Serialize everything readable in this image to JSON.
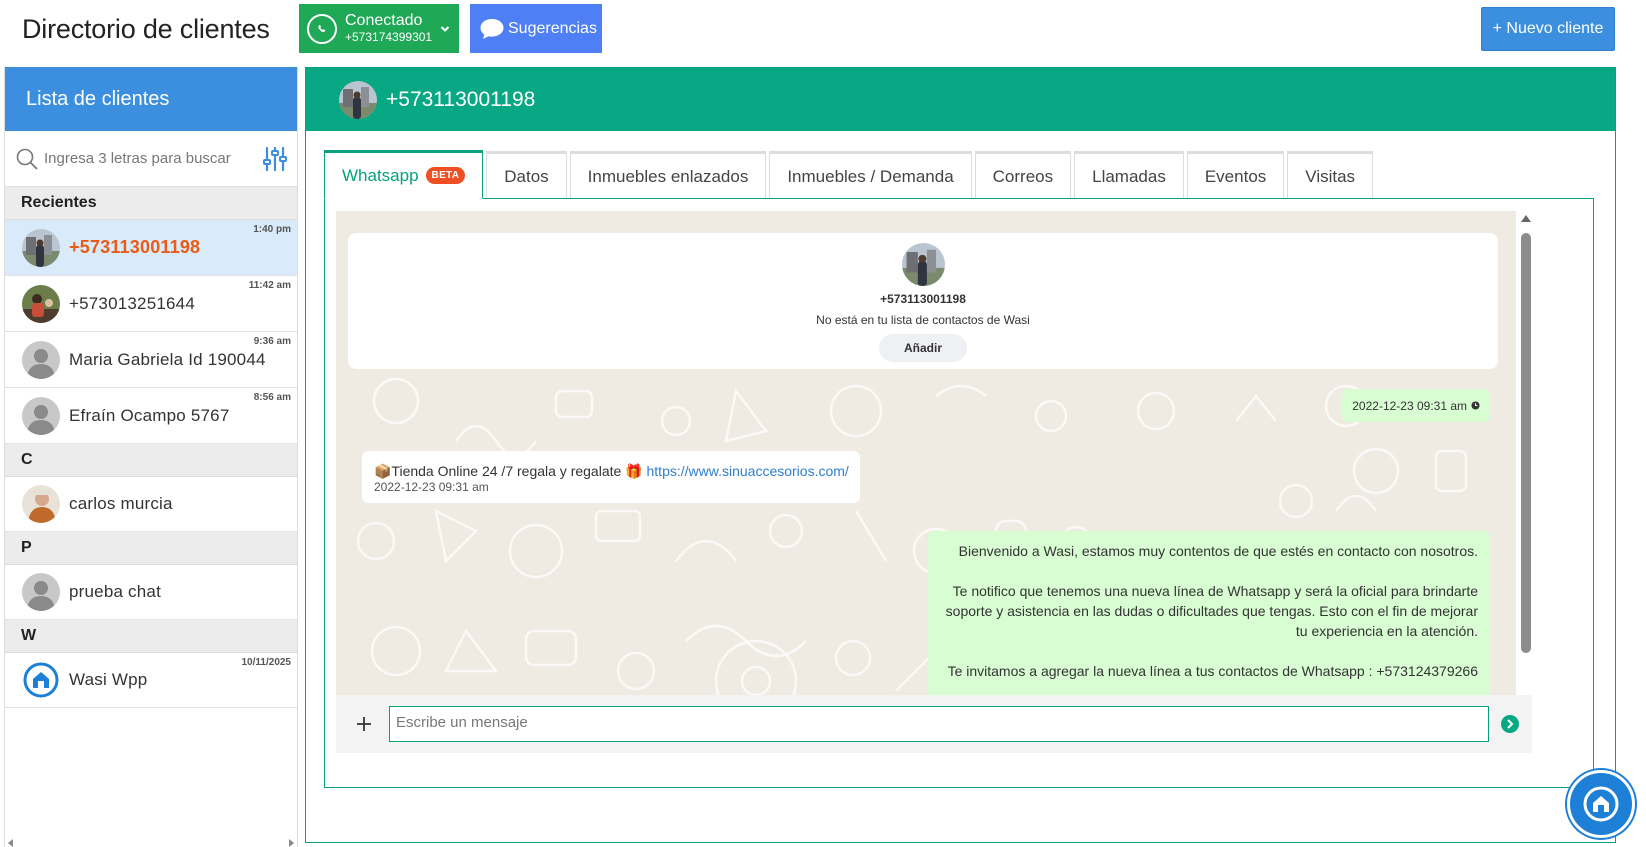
{
  "header": {
    "title": "Directorio de clientes",
    "whatsapp_state": "Conectado",
    "whatsapp_phone": "+573174399301",
    "suggestions_label": "Sugerencias",
    "new_client_label": "+ Nuevo cliente"
  },
  "sidebar": {
    "title": "Lista de clientes",
    "search_placeholder": "Ingresa 3 letras para buscar",
    "sections": [
      {
        "label": "Recientes",
        "contacts": [
          {
            "name": "+573113001198",
            "time": "1:40 pm",
            "active": true
          },
          {
            "name": "+573013251644",
            "time": "11:42 am"
          },
          {
            "name": "Maria Gabriela Id 190044",
            "time": "9:36 am"
          },
          {
            "name": "Efraín Ocampo 5767",
            "time": "8:56 am"
          }
        ]
      },
      {
        "label": "C",
        "contacts": [
          {
            "name": "carlos murcia",
            "time": ""
          }
        ]
      },
      {
        "label": "P",
        "contacts": [
          {
            "name": "prueba chat",
            "time": ""
          }
        ]
      },
      {
        "label": "W",
        "contacts": [
          {
            "name": "Wasi Wpp",
            "time": "10/11/2025"
          }
        ]
      }
    ]
  },
  "main": {
    "contact_phone": "+573113001198",
    "tabs": [
      {
        "label": "Whatsapp",
        "badge": "BETA",
        "active": true
      },
      {
        "label": "Datos"
      },
      {
        "label": "Inmuebles enlazados"
      },
      {
        "label": "Inmuebles / Demanda"
      },
      {
        "label": "Correos"
      },
      {
        "label": "Llamadas"
      },
      {
        "label": "Eventos"
      },
      {
        "label": "Visitas"
      }
    ],
    "chat": {
      "card_phone": "+573113001198",
      "card_note": "No está en tu lista de contactos de Wasi",
      "add_label": "Añadir",
      "out_time_bubble": "2022-12-23 09:31 am",
      "in_message_text": "📦Tienda Online 24 /7 regala y regalate 🎁",
      "in_message_link": "https://www.sinuaccesorios.com/",
      "in_message_time": "2022-12-23 09:31 am",
      "out_message_p1": "Bienvenido a Wasi, estamos muy contentos de que estés en contacto con nosotros.",
      "out_message_p2": "Te notifico que tenemos una nueva línea de Whatsapp y será la oficial para brindarte soporte y asistencia en las dudas o dificultades que tengas. Esto con el fin de mejorar tu experiencia en la atención.",
      "out_message_p3": "Te invitamos a agregar la nueva línea a tus contactos de Whatsapp : +573124379266",
      "composer_placeholder": "Escribe un mensaje"
    }
  },
  "colors": {
    "whatsapp_green": "#1fa855",
    "teal": "#08a884",
    "blue": "#3b8fde",
    "suggestions_blue": "#4f7ff4",
    "active_contact": "#ea5b17",
    "beta_badge": "#ee5023"
  }
}
